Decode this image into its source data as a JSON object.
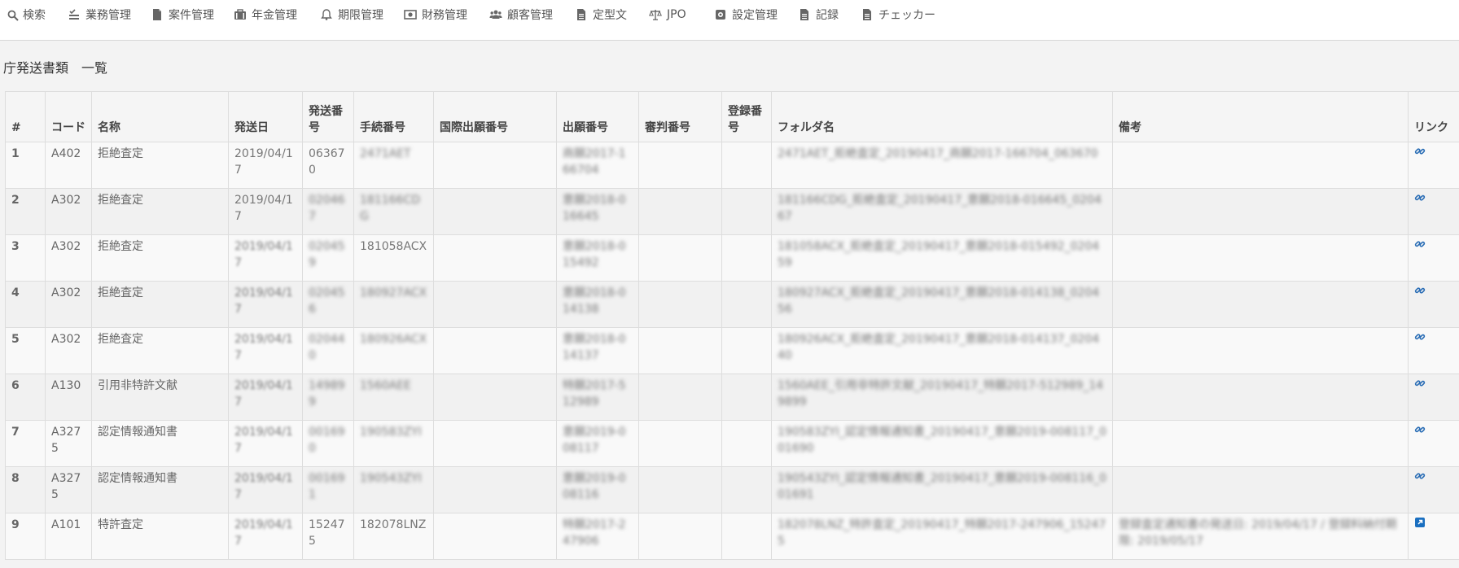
{
  "nav": [
    {
      "label": "検索",
      "icon": "search-icon"
    },
    {
      "label": "業務管理",
      "icon": "tasks-icon"
    },
    {
      "label": "案件管理",
      "icon": "file-icon"
    },
    {
      "label": "年金管理",
      "icon": "briefcase-icon"
    },
    {
      "label": "期限管理",
      "icon": "bell-icon"
    },
    {
      "label": "財務管理",
      "icon": "money-icon"
    },
    {
      "label": "顧客管理",
      "icon": "users-icon"
    },
    {
      "label": "定型文",
      "icon": "file-text-icon"
    },
    {
      "label": "JPO",
      "icon": "balance-scale-icon"
    },
    {
      "label": "設定管理",
      "icon": "cog-icon"
    },
    {
      "label": "記録",
      "icon": "file-text-icon"
    },
    {
      "label": "チェッカー",
      "icon": "file-text-icon"
    }
  ],
  "title": "庁発送書類　一覧",
  "table": {
    "headers": [
      "#",
      "コード",
      "名称",
      "発送日",
      "発送番号",
      "手続番号",
      "国際出願番号",
      "出願番号",
      "審判番号",
      "登録番号",
      "フォルダ名",
      "備考",
      "リンク"
    ],
    "rows": [
      {
        "idx": "1",
        "code": "A402",
        "name": "拒絶査定",
        "date": "2019/04/17",
        "send_no": "063670",
        "proc_no": "2471AET",
        "intl_no": "",
        "app_no": "商願2017-166704",
        "appeal_no": "",
        "reg_no": "",
        "folder": "2471AET_拒絶査定_20190417_商願2017-166704_063670",
        "note": "",
        "link_type": "link"
      },
      {
        "idx": "2",
        "code": "A302",
        "name": "拒絶査定",
        "date": "2019/04/17",
        "send_no": "020467",
        "proc_no": "181166CDG",
        "intl_no": "",
        "app_no": "意願2018-016645",
        "appeal_no": "",
        "reg_no": "",
        "folder": "181166CDG_拒絶査定_20190417_意願2018-016645_020467",
        "note": "",
        "link_type": "link"
      },
      {
        "idx": "3",
        "code": "A302",
        "name": "拒絶査定",
        "date": "2019/04/17",
        "send_no": "020459",
        "proc_no": "181058ACX",
        "intl_no": "",
        "app_no": "意願2018-015492",
        "appeal_no": "",
        "reg_no": "",
        "folder": "181058ACX_拒絶査定_20190417_意願2018-015492_020459",
        "note": "",
        "link_type": "link"
      },
      {
        "idx": "4",
        "code": "A302",
        "name": "拒絶査定",
        "date": "2019/04/17",
        "send_no": "020456",
        "proc_no": "180927ACX",
        "intl_no": "",
        "app_no": "意願2018-014138",
        "appeal_no": "",
        "reg_no": "",
        "folder": "180927ACX_拒絶査定_20190417_意願2018-014138_020456",
        "note": "",
        "link_type": "link"
      },
      {
        "idx": "5",
        "code": "A302",
        "name": "拒絶査定",
        "date": "2019/04/17",
        "send_no": "020440",
        "proc_no": "180926ACX",
        "intl_no": "",
        "app_no": "意願2018-014137",
        "appeal_no": "",
        "reg_no": "",
        "folder": "180926ACX_拒絶査定_20190417_意願2018-014137_020440",
        "note": "",
        "link_type": "link"
      },
      {
        "idx": "6",
        "code": "A130",
        "name": "引用非特許文献",
        "date": "2019/04/17",
        "send_no": "149899",
        "proc_no": "1560AEE",
        "intl_no": "",
        "app_no": "特願2017-512989",
        "appeal_no": "",
        "reg_no": "",
        "folder": "1560AEE_引用非特許文献_20190417_特願2017-512989_149899",
        "note": "",
        "link_type": "link"
      },
      {
        "idx": "7",
        "code": "A3275",
        "name": "認定情報通知書",
        "date": "2019/04/17",
        "send_no": "001690",
        "proc_no": "190583ZYI",
        "intl_no": "",
        "app_no": "意願2019-008117",
        "appeal_no": "",
        "reg_no": "",
        "folder": "190583ZYI_認定情報通知書_20190417_意願2019-008117_001690",
        "note": "",
        "link_type": "link"
      },
      {
        "idx": "8",
        "code": "A3275",
        "name": "認定情報通知書",
        "date": "2019/04/17",
        "send_no": "001691",
        "proc_no": "190543ZYI",
        "intl_no": "",
        "app_no": "意願2019-008116",
        "appeal_no": "",
        "reg_no": "",
        "folder": "190543ZYI_認定情報通知書_20190417_意願2019-008116_001691",
        "note": "",
        "link_type": "link"
      },
      {
        "idx": "9",
        "code": "A101",
        "name": "特許査定",
        "date": "2019/04/17",
        "send_no": "152475",
        "proc_no": "182078LNZ",
        "intl_no": "",
        "app_no": "特願2017-247906",
        "appeal_no": "",
        "reg_no": "",
        "folder": "182078LNZ_特許査定_20190417_特願2017-247906_152475",
        "note": "登録査定通知書の発送日: 2019/04/17 / 登録料納付期限: 2019/05/17",
        "link_type": "external"
      }
    ]
  },
  "colors": {
    "link": "#2a6db5",
    "external": "#1a6fc0"
  }
}
